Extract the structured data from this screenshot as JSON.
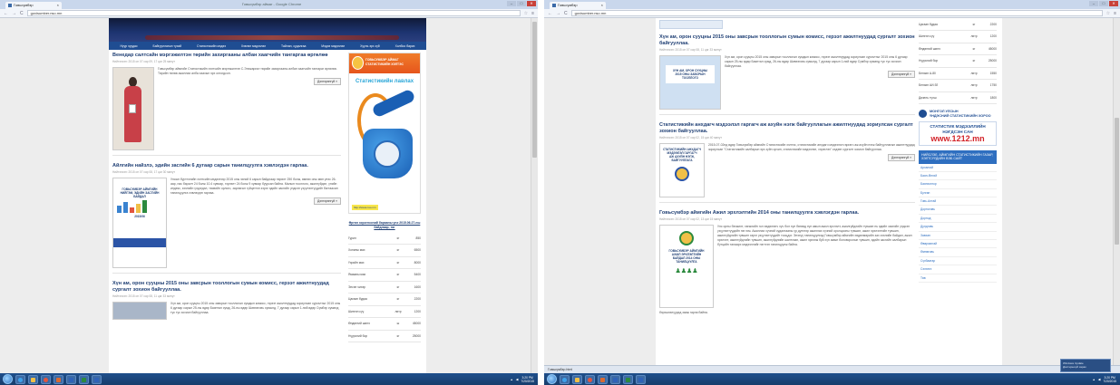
{
  "browser": {
    "tab_title": "Говьсүмбэр",
    "window_title": "Говьсүмбэр аймаг - Google Chrome",
    "url": "govisumber.nso.mn",
    "min": "–",
    "max": "□",
    "close": "✕"
  },
  "nav_menu": [
    "Нүүр хуудас",
    "Байгууллагын тухай",
    "Статистикийн мэдээ",
    "Хэвлэл мэдээлэл",
    "Тайлан, судалгаа",
    "Мэдээ мэдээлэл",
    "Хууль эрх зүй",
    "Холбоо барих"
  ],
  "posts": [
    {
      "title": "Венедар салтсайн мэргэжилтэн төрийн захиргааны албан хаагчийн тангаргаа өргөлөө",
      "meta": "Нийтэлсэн: 2015 он 07 сар 09, 17 цаг 25 минут",
      "text": "Говьсүмбэр аймгийн Статистикийн хэлтсийн мэргэжилтэн С.Энхжаргал төрийн захиргааны албан хаагчийн тангараг өргөлөө. Төрийн төлөө ажиллах алба хаахын эрх олгогдсон.",
      "more": "Дэлгэрэнгүй »"
    },
    {
      "title": "Айлгийн найзлэ, эдийн засгийн 6 дугаар сарын танилцуулга хэвлэгдэн гарлаа.",
      "meta": "Нийтэлсэн: 2015 он 07 сар 08, 17 цаг 30 минут",
      "thumb_lines": [
        "ГОВЬСҮМБЭР АЙМГИЙН",
        "НИЙГЭМ, ЭДИЙН ЗАСГИЙН",
        "БАЙДАЛ"
      ],
      "thumb_year": "2015/06",
      "text": "Улсын бүртгэлийн хэлтсийн мэдээгээр 2015 оны эхний 6 сарын байдлаар төрөлт 250 болж, өмнөх оны мөн үеэс 26-аар, нас баралт 24 болж 10.4 хувиар, гэрлэлт 24 болж 9 хувиар буурсан байна. Малын тооллого, ажилгүйдэл, үнийн индекс, зээлийн үлдэгдэл, төсвийн орлого, зарлагын гүйцэтгэл зэрэг эдийн засгийн үндсэн үзүүлэлтүүдийг багтаасан танилцуулга хэвлэгдэн гарлаа.",
      "more": "Дэлгэрэнгүй »"
    },
    {
      "title": "Хүн ам, орон сууцны 2015 оны завсрын тооллогын сумын комисс, герээт ажилтнуудад сургалт зохион байгууллаа.",
      "meta": "Нийтэлсэн: 2015 он 07 сар 08, 11 цаг 33 минут",
      "thumb_lines": [
        "ХҮН АМ, ОРОН СУУЦНЫ",
        "2015 ОНЫ ЗАВСРЫН",
        "ТООЛЛОГО"
      ],
      "text": "Хүн ам, орон сууцны 2015 оны завсрын тооллогын сумдын комисс, гэрээт ажилтнуудад зориулсан сургалтыг 2015 оны 6 дугаар сарын 25-ны өдөр Баянтал сумд, 26-ны өдөр Шивээговь сумынд, 7 дугаар сарын 1-ний өдөр Сүмбэр суманд тус тус зохион байгууллаа.",
      "more": "Дэлгэрэнгүй »"
    },
    {
      "title": "Статистикийн анхдагч мэдээлэл гаргагч аж ахуйн нэгж байгууллагын ажилтнуудад зориулсан сургалт зохион байгууллаа.",
      "meta": "Нийтэлсэн: 2015 он 07 сар 02, 15 цаг 40 минут",
      "thumb_lines": [
        "СТАТИСТИКИЙН АНХДАГЧ",
        "МЭДЭЭЛЭЛ ГАРГАГЧ",
        "АЖ АХУЙН НЭГЖ, БАЙГУУЛЛАГА"
      ],
      "text": "2015-07-02нд өдөр Говьсүмбэр аймгийн Статистикийн хэлтэс, статистикийн анхдагч мэдээлэл гаргагч аж ахуйн нэгж байгууллагын ажилтнуудад зориулсан \"Статистикийн салбарын эрх зүйн орчин, статистикийн мэдээлэл, хэрэглээ\" сэдэвт сургалт зохион байгууллаа.",
      "more": "Дэлгэрэнгүй »"
    },
    {
      "title": "Говьсүмбэр аймгийн Ажил эрхлэлтийн 2014 оны танилцуулга хэвлэгдэн гарлаа.",
      "meta": "Нийтэлсэн: 2015 он 07 сар 02, 13 цаг 15 минут",
      "thumb_lines": [
        "ГОВЬСҮМБЭР АЙМГИЙН",
        "АЖИЛ ЭРХЛЭЛТИЙН",
        "БАЙДАЛ 2014 ОНЫ",
        "ТАНИЛЦУУЛГА"
      ],
      "text": "Улс орны бэхжилт, хөгжлийн гол хөдөлгөгч хүч бол хүн бөгөөд хүн амын ажил эрхлэлт, ажилгүйдлийн түвшин нь эдийн засгийн үндсэн үзүүлэлтүүдийн нэг юм. Ажиллах хүчний судалгааны үр дүнгээр ажиллах хүчний оролцооны түвшин, ажил эрхлэлтийн түвшин, ажилгүйдлийн түвшин зэрэг үзүүлэлтүүдийг тооцдог. Энэхүү танилцуулгад Говьсүмбэр аймгийн хөдөлмөрийн зах зээлийн байдал, ажил эрхлэлт, ажилгүйдлийн түвшин, ажилгүйдлийн шалтгаан, ажил эрхэлж буй хүн амын боловсролын түвшин, эдийн засгийн салбарын бүтцийн талаарх мэдээллийг нэгтгэн танилцуулж байна.",
      "tail": "бэрхшээлүүдэд зааж гарла байна.",
      "more": "Дэлгэрэнгүй »"
    }
  ],
  "sidebar": {
    "ad_top": "ГОВЬСҮМБЭР АЙМАГ\nСТАТИСТИКИЙН ХЭЛТЭС",
    "ad_title": "Статистикийн лавлах",
    "ad_footer": "http://www.nso.mn",
    "prices_heading": "Өргөн хэрэглээний барааны үнэ 2015.06.27-ны байдлаар, төг",
    "prices": [
      [
        "Гурил",
        "кг",
        "850"
      ],
      [
        "Хонины мах",
        "кг",
        "6500"
      ],
      [
        "Үхрийн мах",
        "кг",
        "8000"
      ],
      [
        "Ямааны мах",
        "кг",
        "5400"
      ],
      [
        "Элсэн чихэр",
        "кг",
        "1600"
      ],
      [
        "Цагаан будаа",
        "кг",
        "2200"
      ],
      [
        "Шингэн сүү",
        "литр",
        "1200"
      ],
      [
        "Өндөгний шинэ",
        "ш",
        "45000"
      ],
      [
        "Нүүрсний бор",
        "кг",
        "25000"
      ]
    ],
    "prices_right": [
      [
        "Цагаан будаа",
        "кг",
        "2200"
      ],
      [
        "Шингэн сүү",
        "литр",
        "1200"
      ],
      [
        "Өндөгний шинэ",
        "кг",
        "45000"
      ],
      [
        "Нүүрсний бор",
        "кг",
        "25000"
      ],
      [
        "Бензин А-80",
        "литр",
        "1550"
      ],
      [
        "Бензин АИ-92",
        "литр",
        "1750"
      ],
      [
        "Дизель түлш",
        "литр",
        "1800"
      ]
    ],
    "logo_text": "МОНГОЛ УЛСЫН\nҮНДЭСНИЙ СТАТИСТИКИЙН ХОРОО",
    "stat_l1": "СТАТИСТИК МЭДЭЭЛЛИЙН",
    "stat_l2": "НЭГДСЭН САН",
    "stat_num": "www.1212.mn",
    "links_head": "НИЙСЛЭЛ, АЙМГИЙН СТАТИСТИКИЙН ГАЗАР, ХЭЛТСҮҮДИЙН ВЭБ САЙТ",
    "links": [
      "Архангай",
      "Баян-Өлгий",
      "Баянхонгор",
      "Булган",
      "Говь-Алтай",
      "Дорноговь",
      "Дорнод",
      "Дундговь",
      "Завхан",
      "Өвөрхангай",
      "Өмнөговь",
      "Сүхбаатар",
      "Сэлэнгэ",
      "Төв"
    ]
  },
  "download_bar": "Говьсүмбэр.html",
  "taskbar": {
    "clock_left": "3:20 PM\n7/20/2015",
    "clock_right": "3:20 PM\n7/20/2015",
    "notify": "Windows Update\nДэлгэрэнгүй харах"
  }
}
